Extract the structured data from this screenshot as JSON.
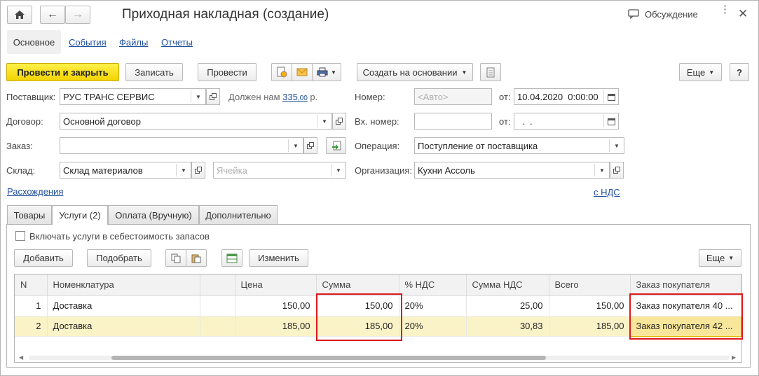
{
  "window": {
    "title": "Приходная накладная (создание)",
    "discussion": "Обсуждение"
  },
  "nav_tabs": [
    "Основное",
    "События",
    "Файлы",
    "Отчеты"
  ],
  "toolbar": {
    "post_close": "Провести и закрыть",
    "save": "Записать",
    "post": "Провести",
    "create_based": "Создать на основании",
    "more": "Еще",
    "help": "?"
  },
  "form": {
    "supplier_label": "Поставщик:",
    "supplier_value": "РУС ТРАНС СЕРВИС",
    "owe_text": "Должен нам",
    "owe_amount": "335",
    "owe_kop": ",00",
    "owe_cur": "р.",
    "contract_label": "Договор:",
    "contract_value": "Основной договор",
    "order_label": "Заказ:",
    "order_value": "",
    "warehouse_label": "Склад:",
    "warehouse_value": "Склад материалов",
    "cell_placeholder": "Ячейка",
    "number_label": "Номер:",
    "number_placeholder": "<Авто>",
    "from_label": "от:",
    "date_value": "10.04.2020  0:00:00",
    "in_number_label": "Вх. номер:",
    "in_date_value": "  .  .",
    "operation_label": "Операция:",
    "operation_value": "Поступление от поставщика",
    "org_label": "Организация:",
    "org_value": "Кухни Ассоль",
    "discrepancies_link": "Расхождения",
    "vat_link": "с НДС"
  },
  "doc_tabs": [
    "Товары",
    "Услуги (2)",
    "Оплата (Вручную)",
    "Дополнительно"
  ],
  "services": {
    "include_cost_label": "Включать услуги в себестоимость запасов",
    "add": "Добавить",
    "pick": "Подобрать",
    "change": "Изменить",
    "more": "Еще"
  },
  "table": {
    "columns": [
      "N",
      "Номенклатура",
      "",
      "Цена",
      "Сумма",
      "% НДС",
      "Сумма НДС",
      "Всего",
      "Заказ покупателя"
    ],
    "rows": [
      [
        "1",
        "Доставка",
        "",
        "150,00",
        "150,00",
        "20%",
        "25,00",
        "150,00",
        "Заказ покупателя 40 ..."
      ],
      [
        "2",
        "Доставка",
        "",
        "185,00",
        "185,00",
        "20%",
        "30,83",
        "185,00",
        "Заказ покупателя 42 ..."
      ]
    ]
  },
  "colors": {
    "accent_yellow": "#f5d800",
    "link_blue": "#1f4f9c",
    "highlight_red": "#e0181b",
    "selected_row": "#fbf3c8"
  }
}
